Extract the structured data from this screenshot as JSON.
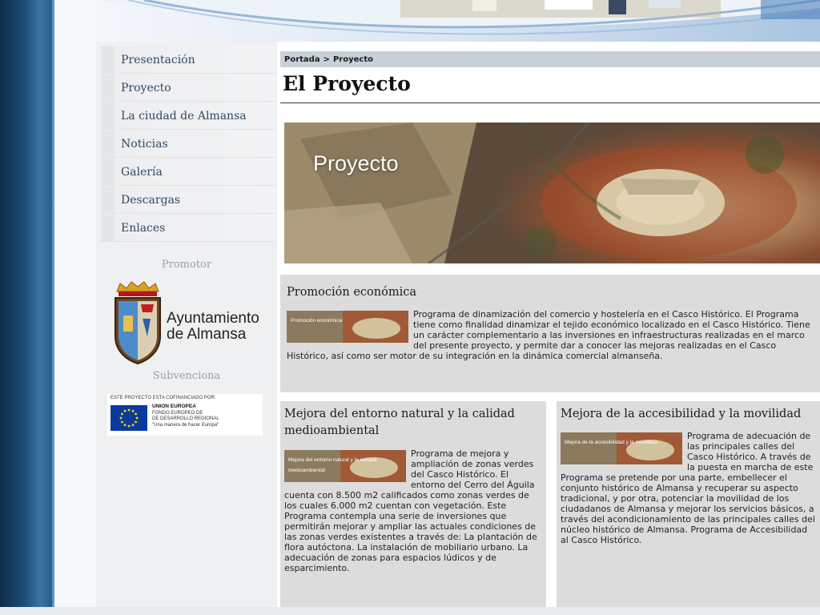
{
  "breadcrumb": {
    "home": "Portada",
    "separator": ">",
    "current": "Proyecto"
  },
  "page": {
    "title": "El Proyecto"
  },
  "hero": {
    "label": "Proyecto"
  },
  "sidebar": {
    "items": [
      {
        "label": "Presentación"
      },
      {
        "label": "Proyecto"
      },
      {
        "label": "La ciudad de Almansa"
      },
      {
        "label": "Noticias"
      },
      {
        "label": "Galería"
      },
      {
        "label": "Descargas"
      },
      {
        "label": "Enlaces"
      }
    ],
    "promotor_heading": "Promotor",
    "promotor_name_line1": "Ayuntamiento",
    "promotor_name_line2": "de Almansa",
    "subvenciona_heading": "Subvenciona",
    "eu": {
      "caption": "ESTE PROYECTO ESTA COFINANCIADO POR:",
      "line1": "UNION EUROPEA",
      "line2": "FONDO EUROPEO DE",
      "line3": "DE DESARROLLO REGIONAL",
      "line4": "\"Una manera de hacer Europa\""
    }
  },
  "sections": {
    "promocion": {
      "title": "Promoción económica",
      "thumb_label": "Promoción económica",
      "text": "Programa de dinamización del comercio y hostelería en el Casco Histórico. El Programa tiene como finalidad dinamizar el tejido económico localizado en el Casco Histórico. Tiene un carácter complementario a las inversiones en infraestructuras realizadas en el marco del presente proyecto, y permite dar a conocer las mejoras realizadas en el Casco Histórico, así como ser motor de su integración en la dinámica comercial almanseña."
    },
    "entorno": {
      "title": "Mejora del entorno natural y la calidad medioambiental",
      "thumb_label": "Mejora del entorno natural y la calidad medioambiental",
      "text": "Programa de mejora y ampliación de zonas verdes del Casco Histórico. El entorno del Cerro del Águila cuenta con 8.500 m2 calificados como zonas verdes de los cuales 6.000 m2 cuentan con vegetación. Este Programa contempla una serie de inversiones que permitirán mejorar y ampliar las actuales condiciones de las zonas verdes existentes a través de: La plantación de flora autóctona. La instalación de mobiliario urbano. La adecuación de zonas para espacios lúdicos y de esparcimiento."
    },
    "accesibilidad": {
      "title": "Mejora de la accesibilidad y la movilidad",
      "thumb_label": "Mejora de la accesibilidad y la movilidad",
      "text": "Programa de adecuación de las principales calles del Casco Histórico. A través de la puesta en marcha de este Programa se pretende por una parte, embellecer el conjunto histórico de Almansa y recuperar su aspecto tradicional, y por otra, potenciar la movilidad de los ciudadanos de Almansa y mejorar los servicios básicos, a través del acondicionamiento de las principales calles del núcleo histórico de Almansa. Programa de Accesibilidad al Casco Histórico."
    }
  },
  "colors": {
    "nav_text": "#2d4a63",
    "block_bg": "#dcdcdc",
    "breadcrumb_bg": "#c8d1d9",
    "stripe": "#1d4e78"
  }
}
